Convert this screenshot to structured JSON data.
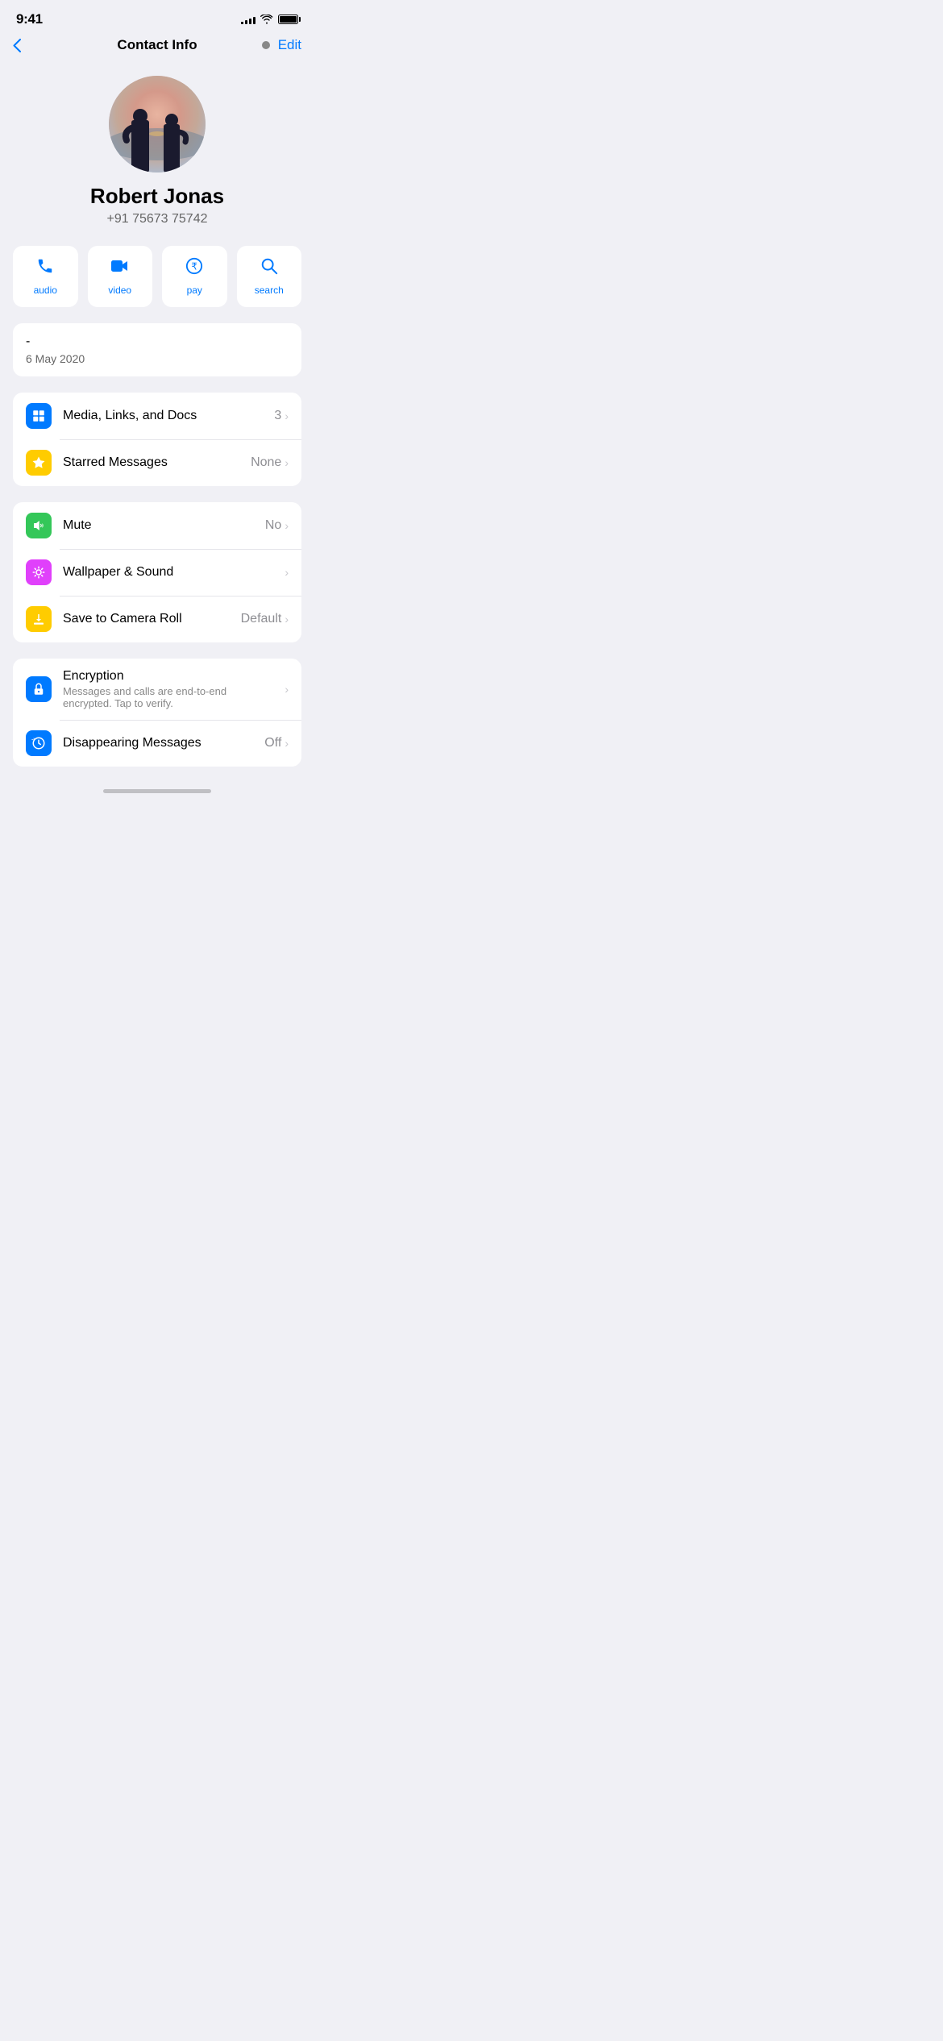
{
  "status": {
    "time": "9:41",
    "signal_bars": [
      3,
      5,
      7,
      9,
      11
    ],
    "battery_percent": 100
  },
  "nav": {
    "back_label": "<",
    "title": "Contact Info",
    "dot_visible": true,
    "edit_label": "Edit"
  },
  "profile": {
    "name": "Robert Jonas",
    "phone": "+91 75673 75742"
  },
  "action_buttons": [
    {
      "id": "audio",
      "label": "audio",
      "icon": "phone"
    },
    {
      "id": "video",
      "label": "video",
      "icon": "video"
    },
    {
      "id": "pay",
      "label": "pay",
      "icon": "rupee"
    },
    {
      "id": "search",
      "label": "search",
      "icon": "search"
    }
  ],
  "info_card": {
    "dash": "-",
    "date": "6 May 2020"
  },
  "section1": {
    "items": [
      {
        "id": "media",
        "label": "Media, Links, and Docs",
        "value": "3",
        "icon_color": "blue"
      },
      {
        "id": "starred",
        "label": "Starred Messages",
        "value": "None",
        "icon_color": "yellow"
      }
    ]
  },
  "section2": {
    "items": [
      {
        "id": "mute",
        "label": "Mute",
        "value": "No",
        "subtitle": "",
        "icon_color": "green"
      },
      {
        "id": "wallpaper",
        "label": "Wallpaper & Sound",
        "value": "",
        "subtitle": "",
        "icon_color": "pink"
      },
      {
        "id": "camera",
        "label": "Save to Camera Roll",
        "value": "Default",
        "subtitle": "",
        "icon_color": "yellow"
      }
    ]
  },
  "section3": {
    "items": [
      {
        "id": "encryption",
        "label": "Encryption",
        "subtitle": "Messages and calls are end-to-end encrypted. Tap to verify.",
        "value": "",
        "icon_color": "blue"
      },
      {
        "id": "disappearing",
        "label": "Disappearing Messages",
        "subtitle": "",
        "value": "Off",
        "icon_color": "blue"
      }
    ]
  }
}
